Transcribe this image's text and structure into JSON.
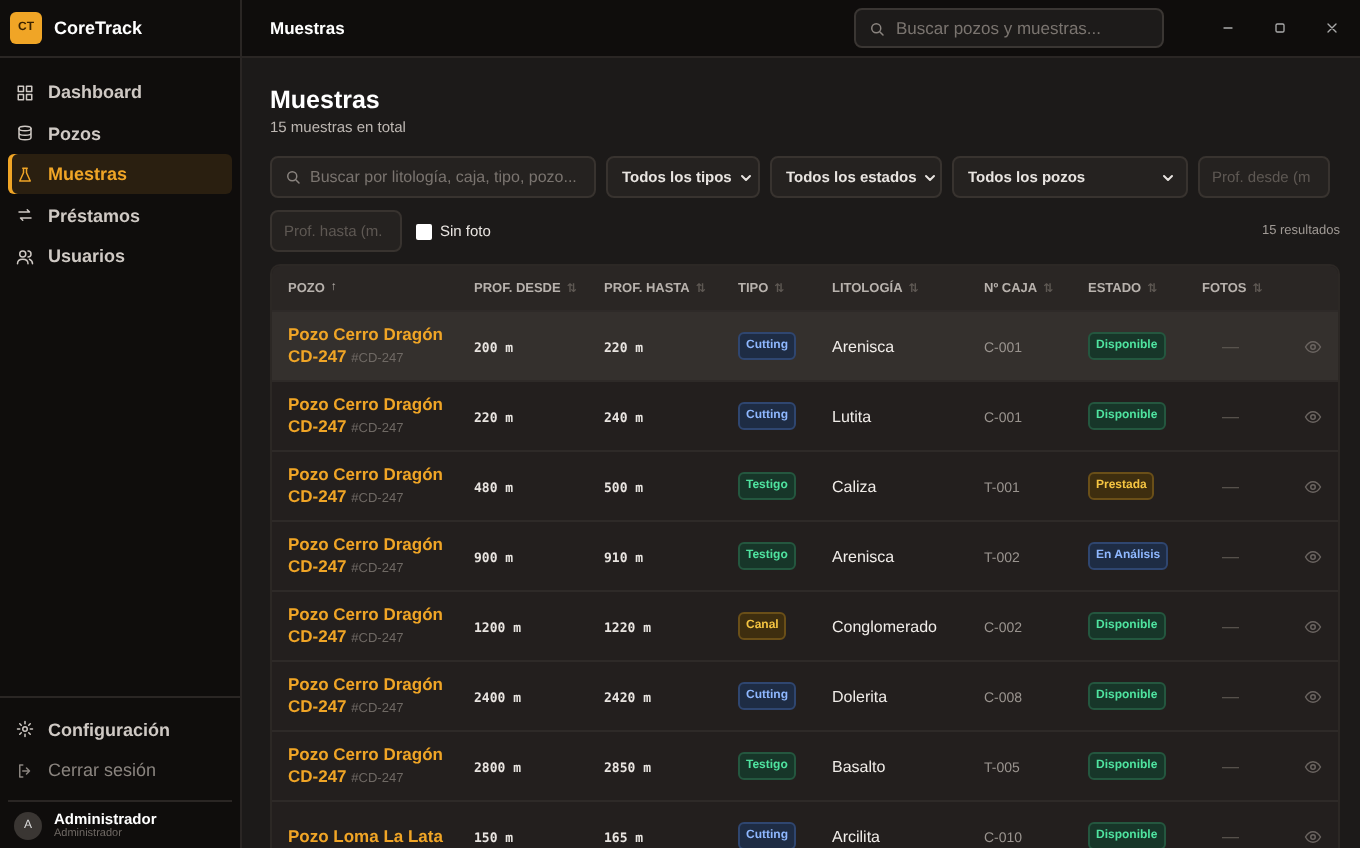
{
  "app": {
    "logo": "CT",
    "name": "CoreTrack"
  },
  "sidebar": {
    "items": [
      {
        "label": "Dashboard",
        "selected": false
      },
      {
        "label": "Pozos",
        "selected": false
      },
      {
        "label": "Muestras",
        "selected": true
      },
      {
        "label": "Préstamos",
        "selected": false
      },
      {
        "label": "Usuarios",
        "selected": false
      }
    ],
    "footer_items": [
      {
        "label": "Configuración"
      },
      {
        "label": "Cerrar sesión"
      }
    ],
    "user": {
      "initial": "A",
      "name": "Administrador",
      "role": "Administrador"
    }
  },
  "topbar": {
    "title": "Muestras",
    "search": {
      "placeholder": "Buscar pozos y muestras..."
    }
  },
  "page": {
    "title": "Muestras",
    "subtitle": "15 muestras en total"
  },
  "filters": {
    "search": {
      "placeholder": "Buscar por litología, caja, tipo, pozo..."
    },
    "selects": [
      "Todos los tipos",
      "Todos los estados",
      "Todos los pozos"
    ],
    "depth_from": {
      "placeholder": "Prof. desde (m"
    },
    "depth_to": {
      "placeholder": "Prof. hasta (m."
    },
    "no_photo": {
      "label": "Sin foto",
      "checked": false
    },
    "result_count": "15 resultados"
  },
  "table": {
    "columns": [
      {
        "label": "POZO",
        "sort": "↑",
        "sorted": true
      },
      {
        "label": "PROF. DESDE",
        "sort": "⇅",
        "sorted": false
      },
      {
        "label": "PROF. HASTA",
        "sort": "⇅",
        "sorted": false
      },
      {
        "label": "TIPO",
        "sort": "⇅",
        "sorted": false
      },
      {
        "label": "LITOLOGÍA",
        "sort": "⇅",
        "sorted": false
      },
      {
        "label": "Nº CAJA",
        "sort": "⇅",
        "sorted": false
      },
      {
        "label": "ESTADO",
        "sort": "⇅",
        "sorted": false
      },
      {
        "label": "FOTOS",
        "sort": "⇅",
        "sorted": false
      }
    ],
    "rows": [
      {
        "pozo": "Pozo Cerro Dragón",
        "code": "CD-247",
        "tag": "#CD-247",
        "desde": "200 m",
        "hasta": "220 m",
        "tipo": "Cutting",
        "litologia": "Arenisca",
        "caja": "C-001",
        "estado": "Disponible",
        "fotos": "—",
        "hovered": true
      },
      {
        "pozo": "Pozo Cerro Dragón",
        "code": "CD-247",
        "tag": "#CD-247",
        "desde": "220 m",
        "hasta": "240 m",
        "tipo": "Cutting",
        "litologia": "Lutita",
        "caja": "C-001",
        "estado": "Disponible",
        "fotos": "—",
        "hovered": false
      },
      {
        "pozo": "Pozo Cerro Dragón",
        "code": "CD-247",
        "tag": "#CD-247",
        "desde": "480 m",
        "hasta": "500 m",
        "tipo": "Testigo",
        "litologia": "Caliza",
        "caja": "T-001",
        "estado": "Prestada",
        "fotos": "—",
        "hovered": false
      },
      {
        "pozo": "Pozo Cerro Dragón",
        "code": "CD-247",
        "tag": "#CD-247",
        "desde": "900 m",
        "hasta": "910 m",
        "tipo": "Testigo",
        "litologia": "Arenisca",
        "caja": "T-002",
        "estado": "En Análisis",
        "fotos": "—",
        "hovered": false
      },
      {
        "pozo": "Pozo Cerro Dragón",
        "code": "CD-247",
        "tag": "#CD-247",
        "desde": "1200 m",
        "hasta": "1220 m",
        "tipo": "Canal",
        "litologia": "Conglomerado",
        "caja": "C-002",
        "estado": "Disponible",
        "fotos": "—",
        "hovered": false
      },
      {
        "pozo": "Pozo Cerro Dragón",
        "code": "CD-247",
        "tag": "#CD-247",
        "desde": "2400 m",
        "hasta": "2420 m",
        "tipo": "Cutting",
        "litologia": "Dolerita",
        "caja": "C-008",
        "estado": "Disponible",
        "fotos": "—",
        "hovered": false
      },
      {
        "pozo": "Pozo Cerro Dragón",
        "code": "CD-247",
        "tag": "#CD-247",
        "desde": "2800 m",
        "hasta": "2850 m",
        "tipo": "Testigo",
        "litologia": "Basalto",
        "caja": "T-005",
        "estado": "Disponible",
        "fotos": "—",
        "hovered": false
      },
      {
        "pozo": "Pozo Loma La Lata",
        "desde": "150 m",
        "hasta": "165 m",
        "tipo": "Cutting",
        "litologia": "Arcilita",
        "caja": "C-010",
        "estado": "Disponible",
        "fotos": "—",
        "hovered": false
      }
    ]
  }
}
